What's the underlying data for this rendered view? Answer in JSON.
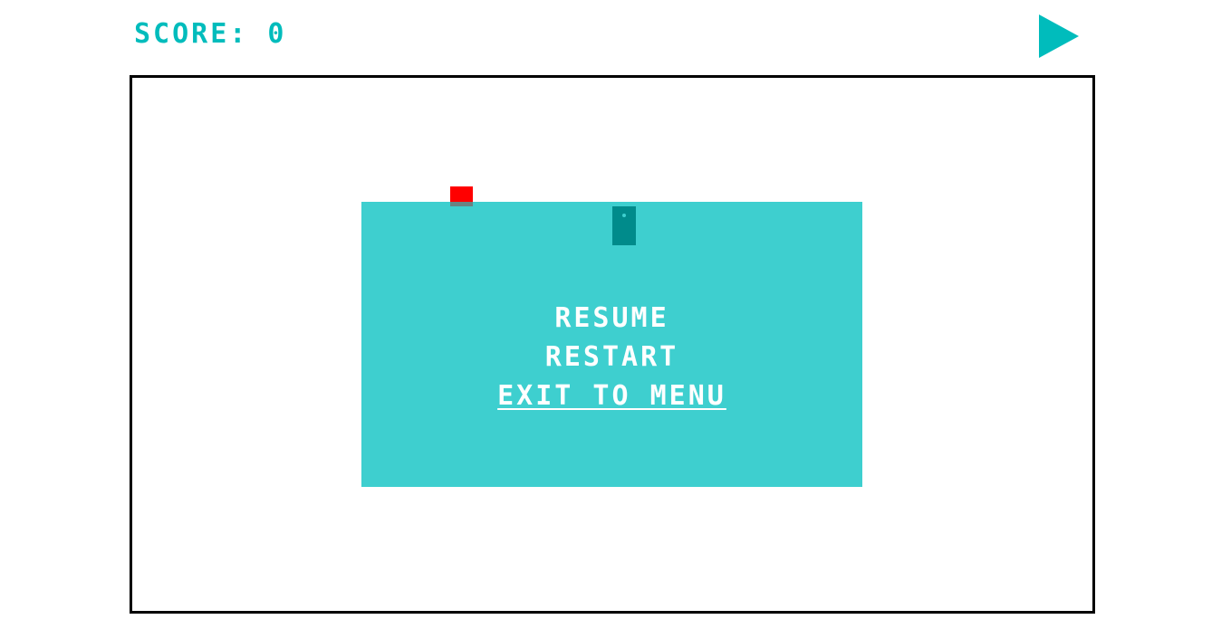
{
  "hud": {
    "score_label": "SCORE: 0",
    "play_icon": "play-icon"
  },
  "pause_menu": {
    "items": [
      {
        "label": "RESUME",
        "selected": false
      },
      {
        "label": "RESTART",
        "selected": false
      },
      {
        "label": "EXIT TO MENU",
        "selected": true
      }
    ]
  },
  "colors": {
    "accent": "#00bcbc",
    "panel": "#3ecfcf",
    "door": "#008b8b",
    "player": "#ff0000",
    "menu_text": "#ffffff",
    "border": "#000000"
  }
}
